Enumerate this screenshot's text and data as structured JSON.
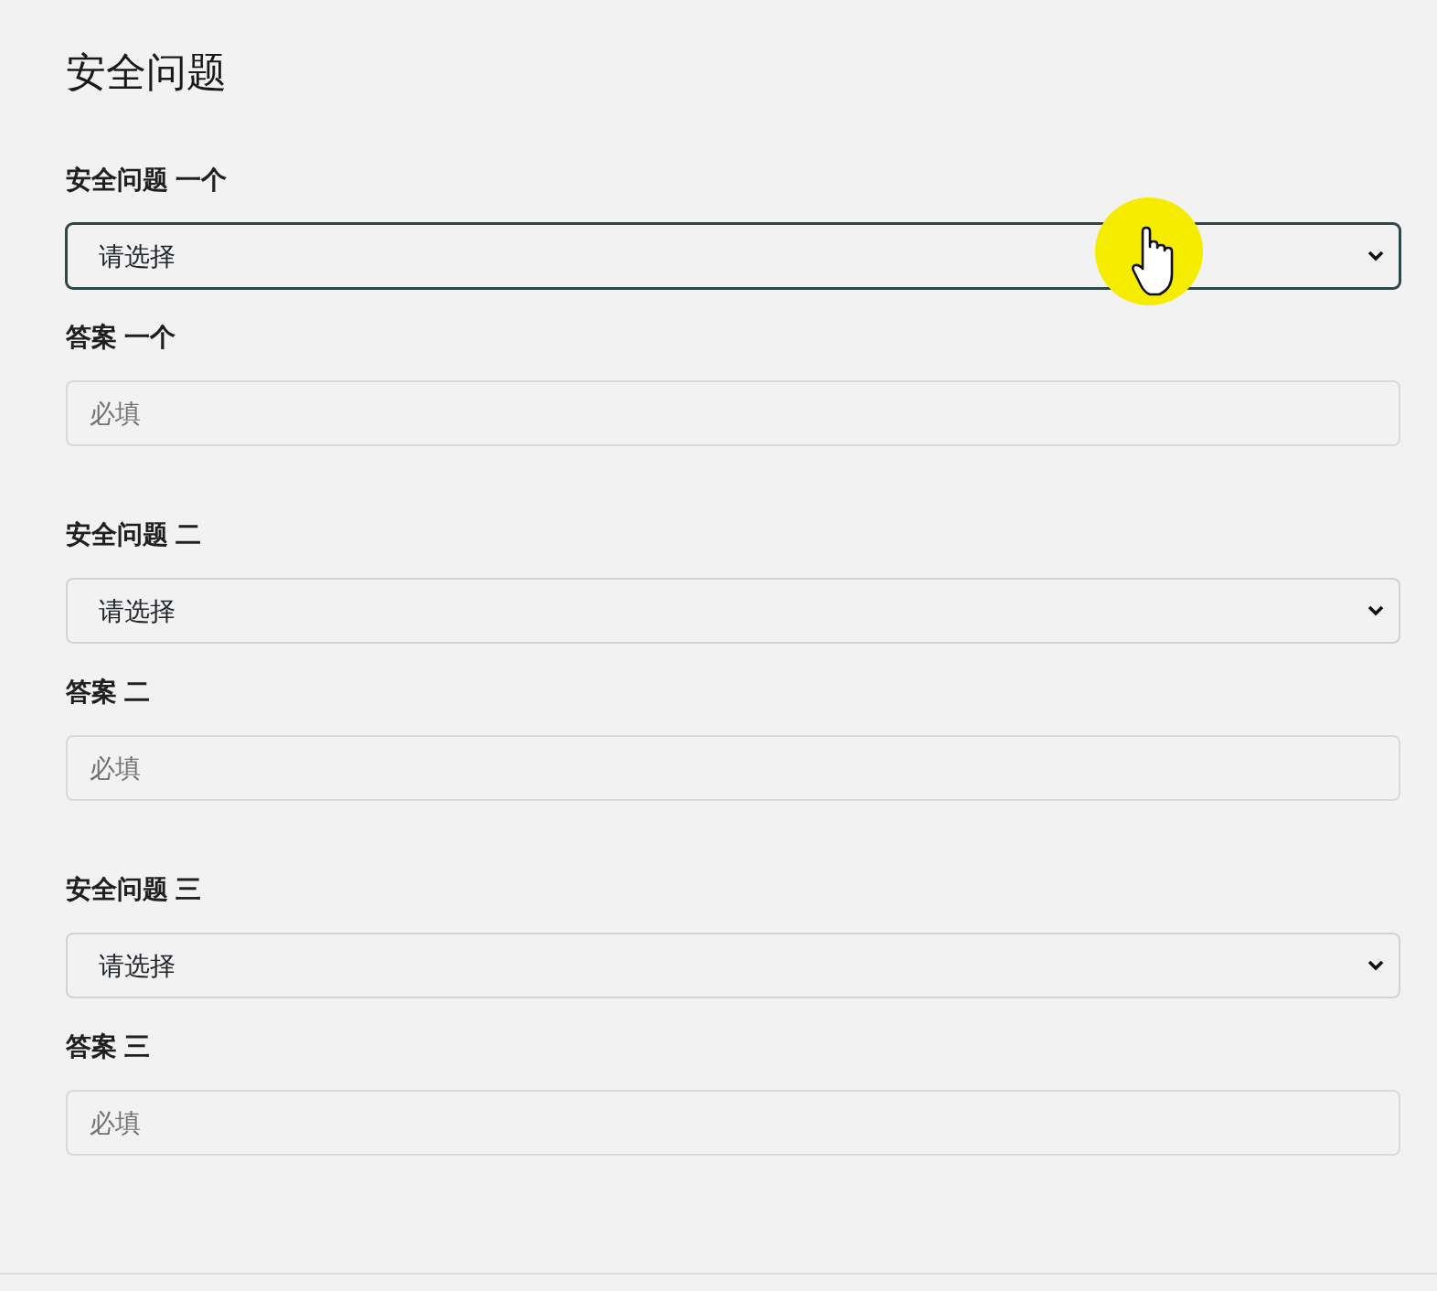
{
  "page": {
    "title": "安全问题"
  },
  "questions": [
    {
      "label": "安全问题 一个",
      "select": {
        "value": "请选择",
        "focused": true
      },
      "answer_label": "答案 一个",
      "answer": {
        "placeholder": "必填"
      }
    },
    {
      "label": "安全问题 二",
      "select": {
        "value": "请选择",
        "focused": false
      },
      "answer_label": "答案 二",
      "answer": {
        "placeholder": "必填"
      }
    },
    {
      "label": "安全问题 三",
      "select": {
        "value": "请选择",
        "focused": false
      },
      "answer_label": "答案 三",
      "answer": {
        "placeholder": "必填"
      }
    }
  ]
}
